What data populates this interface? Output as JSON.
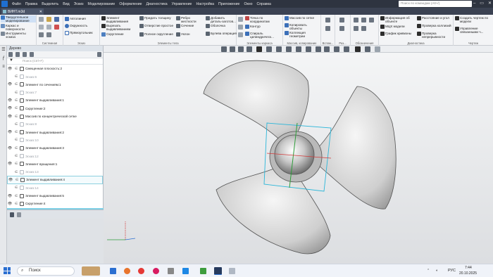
{
  "menubar": {
    "items": [
      "Файл",
      "Правка",
      "Выделить",
      "Вид",
      "Эскиз",
      "Моделирование",
      "Оформление",
      "Диагностика",
      "Управление",
      "Настройка",
      "Приложение",
      "Окно",
      "Справка"
    ],
    "search_placeholder": "Поиск по командам (Alt+/)",
    "window_controls": [
      "–",
      "▭",
      "✕"
    ]
  },
  "document_tab": {
    "label": "ВИНТ.m3d",
    "close": "✕"
  },
  "ribbon": {
    "modes": [
      "Твердотельное моделирование",
      "Каркас и поверхности",
      "Инструменты эскиза"
    ],
    "groups": [
      {
        "title": "Системная"
      },
      {
        "title": "Эскиз",
        "items": [
          "Автолиния",
          "Окружность",
          "Прямоугольник"
        ]
      },
      {
        "title": "Элементы тела",
        "items": [
          "Элемент выдавливания",
          "Вырезать выдавливанием",
          "Скругление",
          "Придать толщину",
          "Отверстие простое",
          "Полное скругление",
          "Ребро жесткости",
          "Сечение",
          "Уклон",
          "Добавить деталь-заготов...",
          "Оболочка",
          "Булева операция"
        ]
      },
      {
        "title": "Элементы каркаса",
        "items": [
          "Точка по координатам",
          "Контур",
          "Спираль цилиндрическ..."
        ]
      },
      {
        "title": "Массив, копирование",
        "items": [
          "Массив по сетке",
          "Копировать объекты",
          "Коллекция геометрии"
        ]
      },
      {
        "title": "Вспом..."
      },
      {
        "title": "Раз..."
      },
      {
        "title": "Обозначения"
      },
      {
        "title": "Диагностика",
        "items": [
          "Информация об объекте",
          "МЦХ модели",
          "График кривизны",
          "Расстояние и угол",
          "Проверка коллизий",
          "Проверка непрерывности"
        ]
      },
      {
        "title": "Чертеж",
        "items": [
          "Создать чертеж по модели",
          "Управление связанными ч..."
        ]
      }
    ]
  },
  "tree": {
    "title": "Дерево",
    "search_placeholder": "Поиск (Ctrl+F)",
    "rows": [
      {
        "label": "Смещенная плоскость:2",
        "kind": "normal"
      },
      {
        "label": "Эскиз:6",
        "kind": "sketch"
      },
      {
        "label": "Элемент по сечениям:1",
        "kind": "normal"
      },
      {
        "label": "Эскиз:7",
        "kind": "sketch"
      },
      {
        "label": "Элемент выдавливания:1",
        "kind": "normal"
      },
      {
        "label": "Скругление:2",
        "kind": "normal"
      },
      {
        "label": "Массив по концентрической сетке",
        "kind": "normal"
      },
      {
        "label": "Эскиз:8",
        "kind": "sketch"
      },
      {
        "label": "Элемент выдавливания:2",
        "kind": "normal"
      },
      {
        "label": "Эскиз:10",
        "kind": "sketch"
      },
      {
        "label": "Элемент выдавливания:3",
        "kind": "normal"
      },
      {
        "label": "Эскиз:12",
        "kind": "sketch"
      },
      {
        "label": "Элемент вращения:1",
        "kind": "normal"
      },
      {
        "label": "Эскиз:13",
        "kind": "sketch"
      },
      {
        "label": "Элемент выдавливания:4",
        "kind": "highlighted"
      },
      {
        "label": "Эскиз:14",
        "kind": "sketch"
      },
      {
        "label": "Элемент выдавливания:5",
        "kind": "normal"
      },
      {
        "label": "Скругление:4",
        "kind": "normal"
      }
    ]
  },
  "taskbar": {
    "search_label": "Поиск",
    "lang": "РУС",
    "time": "7:44",
    "date": "20.10.2025"
  },
  "colors": {
    "accent": "#1f6fd1",
    "highlight": "#7fd0e6",
    "bbox_cyan": "#2bb6d9",
    "axis_green": "#2e9d3a",
    "axis_red": "#d23b3b"
  }
}
